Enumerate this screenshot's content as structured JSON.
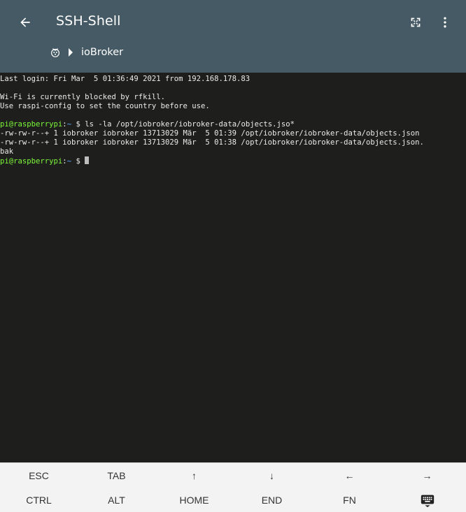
{
  "appbar": {
    "title": "SSH-Shell",
    "icons": {
      "back": "arrow-back-icon",
      "fullscreen": "fullscreen-icon",
      "more": "more-vert-icon"
    },
    "color": "#455a64"
  },
  "breadcrumb": {
    "items": [
      {
        "icon": "raspberry-icon"
      },
      {
        "icon": "chevron-right-icon"
      },
      {
        "label": "ioBroker"
      }
    ]
  },
  "terminal": {
    "lines": {
      "l1": "Last login: Fri Mar  5 01:36:49 2021 from 192.168.178.83",
      "l2": "Wi-Fi is currently blocked by rfkill.",
      "l3": "Use raspi-config to set the country before use.",
      "l4_cmd": "ls -la /opt/iobroker/iobroker-data/objects.jso*",
      "l5": "-rw-rw-r--+ 1 iobroker iobroker 13713029 Mär  5 01:39 /opt/iobroker/iobroker-data/objects.json",
      "l6": "-rw-rw-r--+ 1 iobroker iobroker 13713029 Mär  5 01:38 /opt/iobroker/iobroker-data/objects.json.",
      "l7": "bak"
    },
    "prompt": {
      "user": "pi@raspberrypi",
      "sep": ":",
      "path": "~",
      "symbol": " $ "
    },
    "colors": {
      "user": "#7df83a",
      "path": "#5aa7ff",
      "text": "#ebebeb",
      "background": "#1e1f1c"
    }
  },
  "keys": {
    "row1": [
      "ESC",
      "TAB",
      "↑",
      "↓",
      "←",
      "→"
    ],
    "row2": [
      "CTRL",
      "ALT",
      "HOME",
      "END",
      "FN"
    ],
    "keyboard_icon": "keyboard-icon"
  }
}
